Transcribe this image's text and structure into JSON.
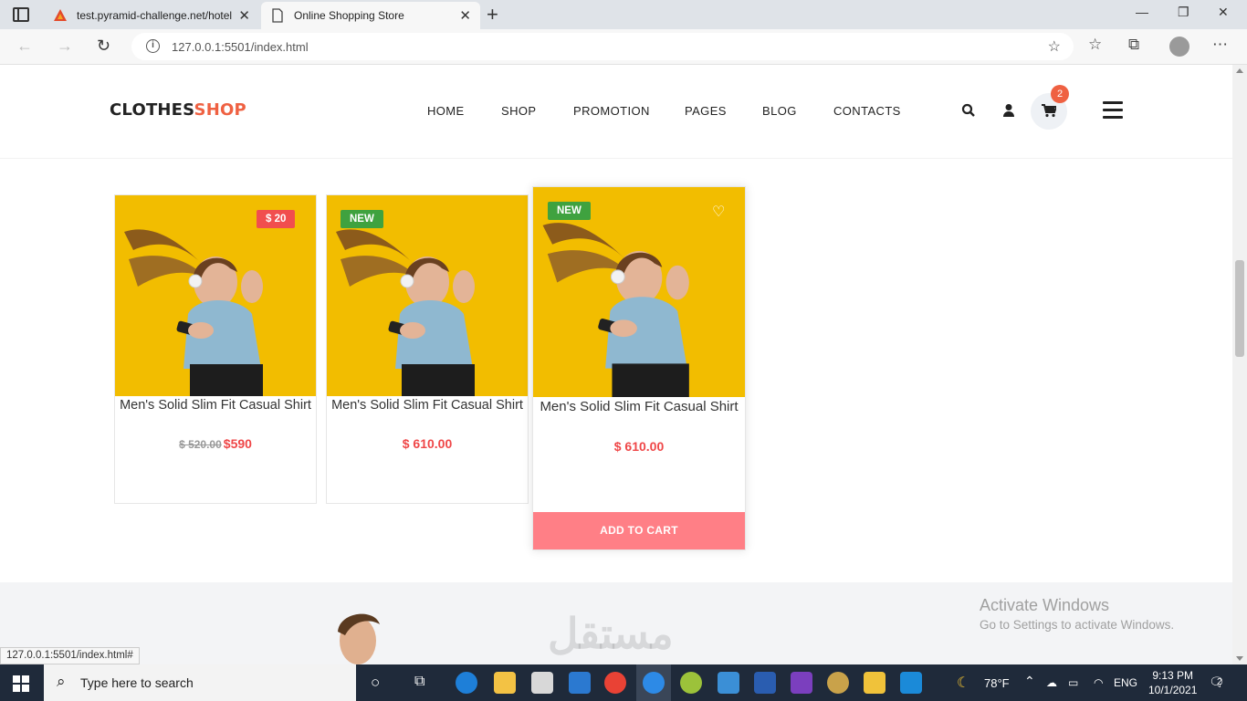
{
  "browser": {
    "tabs": [
      {
        "title": "test.pyramid-challenge.net/hotel",
        "active": false
      },
      {
        "title": "Online Shopping Store",
        "active": true
      }
    ],
    "url": "127.0.0.1:5501/index.html",
    "status_url": "127.0.0.1:5501/index.html#"
  },
  "site": {
    "logo_part1": "CLOTHES",
    "logo_part2": "SHOP",
    "nav": [
      "HOME",
      "SHOP",
      "PROMOTION",
      "PAGES",
      "BLOG",
      "CONTACTS"
    ],
    "cart_count": "2"
  },
  "products": [
    {
      "title": "Men's Solid Slim Fit Casual Shirt",
      "tag": "$ 20",
      "tag_type": "sale",
      "old_price": "$ 520.00",
      "price": "$590"
    },
    {
      "title": "Men's Solid Slim Fit Casual Shirt",
      "tag": "NEW",
      "tag_type": "new",
      "price": "$ 610.00"
    },
    {
      "title": "Men's Solid Slim Fit Casual Shirt",
      "tag": "NEW",
      "tag_type": "new",
      "price": "$ 610.00",
      "button": "ADD TO CART"
    }
  ],
  "overlay": {
    "activate_title": "Activate Windows",
    "activate_sub": "Go to Settings to activate Windows."
  },
  "taskbar": {
    "search_placeholder": "Type here to search",
    "weather": "78°F",
    "language": "ENG",
    "time": "9:13 PM",
    "date": "10/1/2021",
    "notifications": "2"
  },
  "colors": {
    "accent": "#ef6142",
    "sale_tag": "#f14e4e",
    "new_tag": "#3fa23f",
    "price": "#ef4748",
    "add_to_cart": "#ff7f86",
    "image_bg": "#f2bd00"
  }
}
